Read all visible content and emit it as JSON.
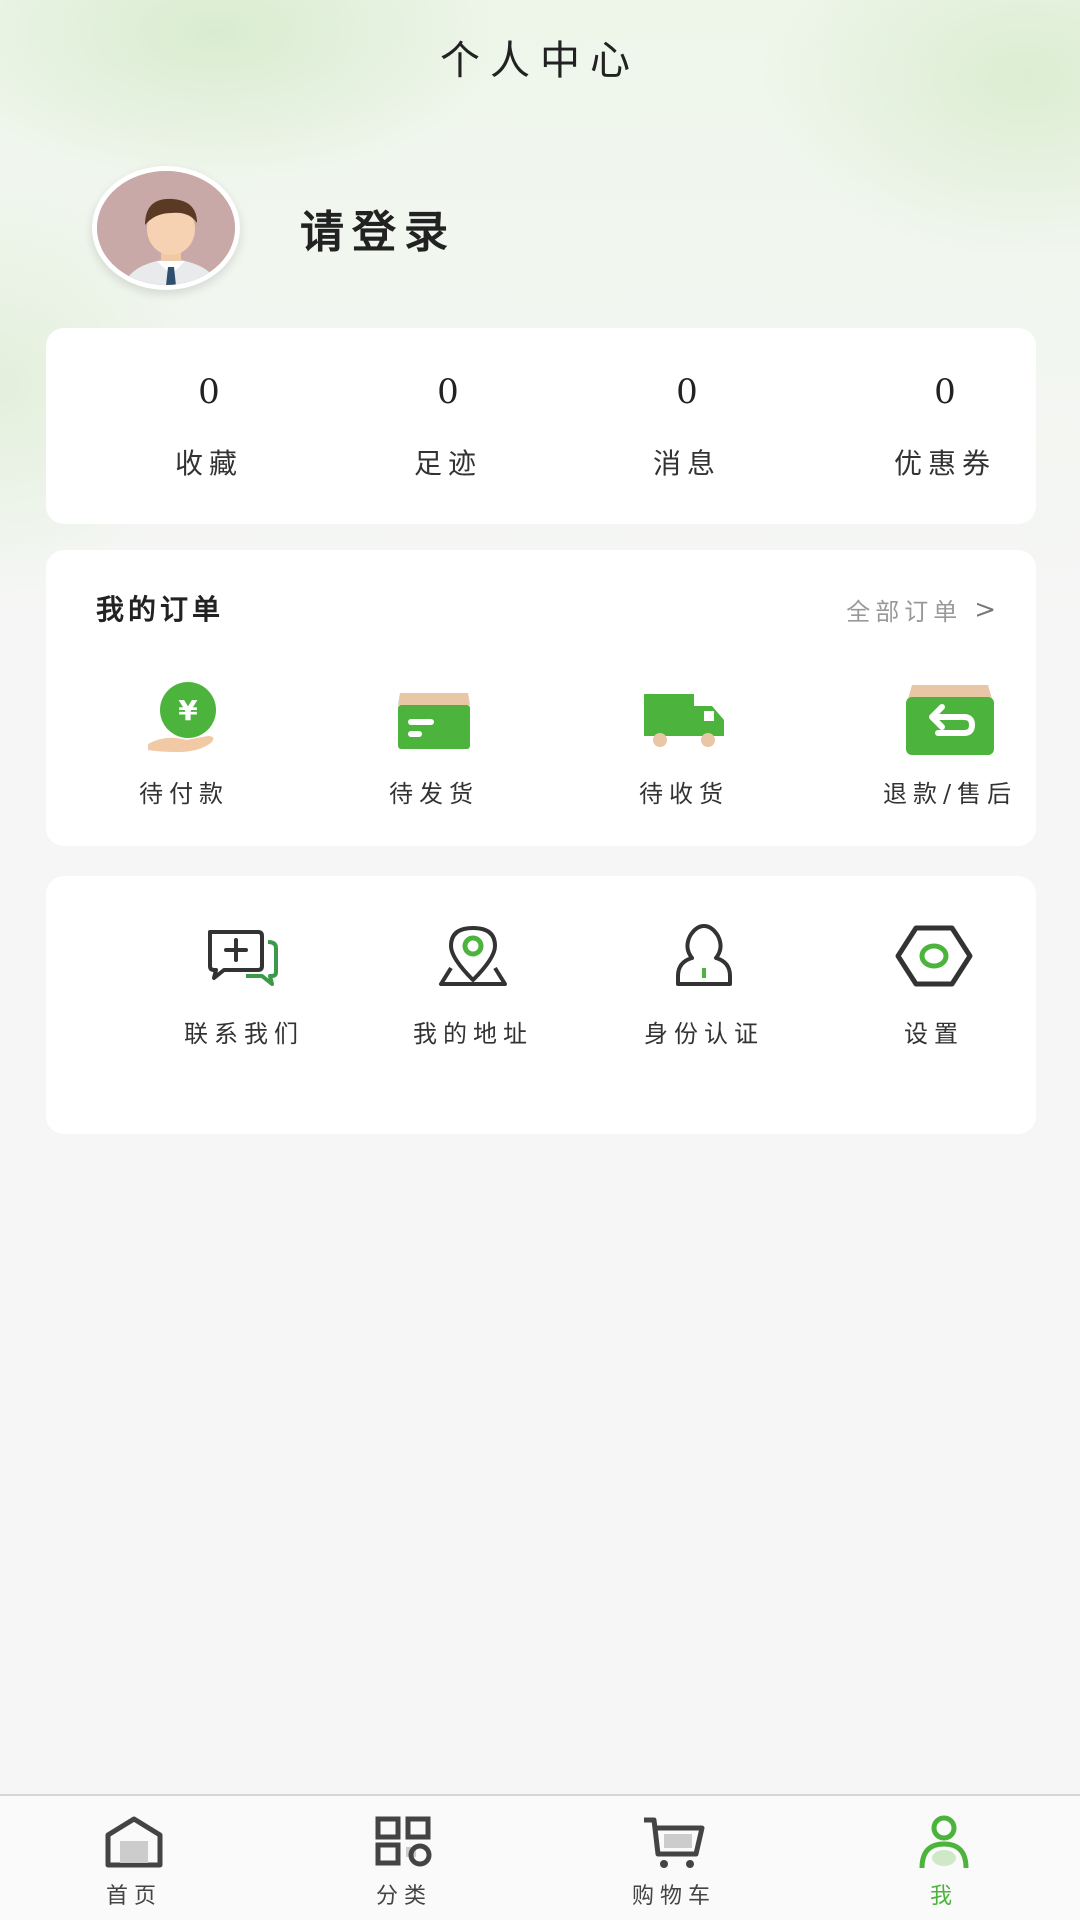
{
  "header": {
    "title": "个人中心"
  },
  "profile": {
    "login_prompt": "请登录"
  },
  "stats": [
    {
      "value": "0",
      "label": "收藏"
    },
    {
      "value": "0",
      "label": "足迹"
    },
    {
      "value": "0",
      "label": "消息"
    },
    {
      "value": "0",
      "label": "优惠券"
    }
  ],
  "orders": {
    "title": "我的订单",
    "all_label": "全部订单",
    "items": [
      {
        "label": "待付款",
        "icon": "payment-icon"
      },
      {
        "label": "待发货",
        "icon": "box-icon"
      },
      {
        "label": "待收货",
        "icon": "truck-icon"
      },
      {
        "label": "退款/售后",
        "icon": "refund-icon"
      }
    ]
  },
  "tools": [
    {
      "label": "联系我们",
      "icon": "chat-icon"
    },
    {
      "label": "我的地址",
      "icon": "location-icon"
    },
    {
      "label": "身份认证",
      "icon": "identity-icon"
    },
    {
      "label": "设置",
      "icon": "settings-icon"
    }
  ],
  "tabbar": [
    {
      "label": "首页",
      "icon": "home-icon"
    },
    {
      "label": "分类",
      "icon": "category-icon"
    },
    {
      "label": "购物车",
      "icon": "cart-icon"
    },
    {
      "label": "我",
      "icon": "user-icon",
      "active": true
    }
  ],
  "colors": {
    "accent": "#4cb43c",
    "background": "#f6f6f6",
    "card": "#ffffff"
  }
}
